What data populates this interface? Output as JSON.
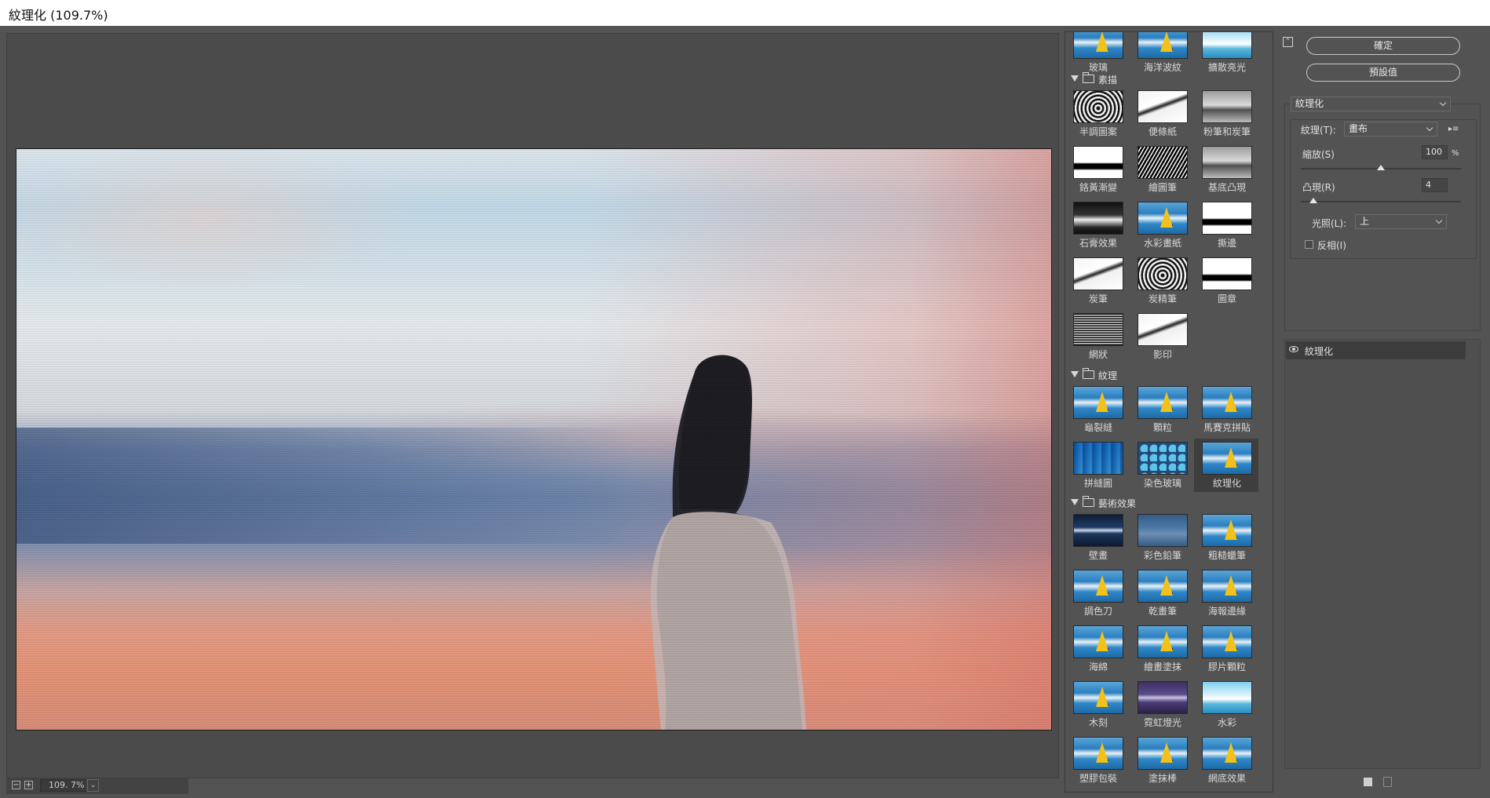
{
  "window": {
    "title": "紋理化 (109.7%)"
  },
  "preview": {
    "zoom": "109.7%"
  },
  "statusbar": {
    "zoom_out": "−",
    "zoom_in": "+",
    "zoom_value": "109. 7%"
  },
  "gallery": {
    "top_row": [
      "玻璃",
      "海洋波紋",
      "擴散亮光"
    ],
    "categories": [
      {
        "name": "素描",
        "filters": [
          "半調圖案",
          "便條紙",
          "粉筆和炭筆",
          "鉻黃漸變",
          "繪圖筆",
          "基底凸現",
          "石膏效果",
          "水彩畫紙",
          "撕邊",
          "炭筆",
          "炭精筆",
          "圖章",
          "網狀",
          "影印"
        ]
      },
      {
        "name": "紋理",
        "filters": [
          "龜裂縫",
          "顆粒",
          "馬賽克拼貼",
          "拼縫圖",
          "染色玻璃",
          "紋理化"
        ]
      },
      {
        "name": "藝術效果",
        "filters": [
          "壁畫",
          "彩色鉛筆",
          "粗糙蠟筆",
          "調色刀",
          "乾畫筆",
          "海報邊緣",
          "海綿",
          "繪畫塗抹",
          "膠片顆粒",
          "木刻",
          "霓虹燈光",
          "水彩",
          "塑膠包裝",
          "塗抹棒",
          "網底效果"
        ]
      }
    ],
    "selected_filter": "紋理化"
  },
  "controls": {
    "ok_label": "確定",
    "default_label": "預設值",
    "filter_select": "紋理化",
    "texture_label": "紋理(T):",
    "texture_value": "畫布",
    "scaling_label": "縮放(S)",
    "scaling_value": "100",
    "scaling_unit": "%",
    "scaling_fraction": 0.5,
    "relief_label": "凸現(R)",
    "relief_value": "4",
    "relief_fraction": 0.08,
    "light_label": "光照(L):",
    "light_value": "上",
    "invert_label": "反相(I)",
    "invert_checked": false
  },
  "layers": {
    "items": [
      {
        "name": "紋理化",
        "visible": true
      }
    ]
  }
}
